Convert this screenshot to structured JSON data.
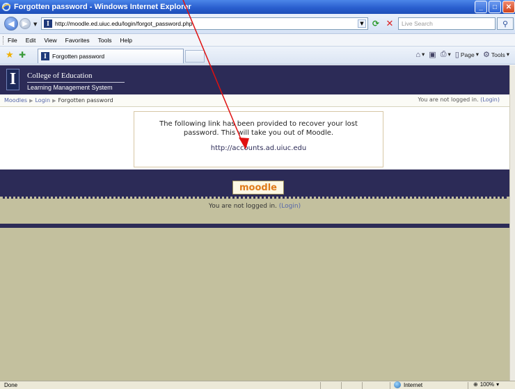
{
  "window": {
    "title": "Forgotten password - Windows Internet Explorer",
    "controls": [
      "minimize",
      "maximize",
      "close"
    ]
  },
  "addressbar": {
    "url": "http://moodle.ed.uiuc.edu/login/forgot_password.php",
    "search_placeholder": "Live Search"
  },
  "menubar": {
    "items": [
      {
        "label": "File"
      },
      {
        "label": "Edit"
      },
      {
        "label": "View"
      },
      {
        "label": "Favorites"
      },
      {
        "label": "Tools"
      },
      {
        "label": "Help"
      }
    ]
  },
  "tabs": {
    "active_tab": "Forgotten password"
  },
  "commandbar": {
    "page_label": "Page",
    "tools_label": "Tools"
  },
  "site": {
    "logo_letter": "I",
    "college": "College of Education",
    "system": "Learning Management System"
  },
  "breadcrumb": {
    "items": [
      "Moodles",
      "Login",
      "Forgotten password"
    ],
    "login_status": "You are not logged in.",
    "login_link": "(Login)"
  },
  "main": {
    "message": "The following link has been provided to recover your lost password. This will take you out of Moodle.",
    "link": "http://accounts.ad.uiuc.edu"
  },
  "footer": {
    "logo_text": "moodle",
    "login_status": "You are not logged in.",
    "login_link": "(Login)"
  },
  "statusbar": {
    "status": "Done",
    "zone": "Internet",
    "zoom": "100%"
  },
  "colors": {
    "header": "#2c2b57",
    "background": "#c3c09e",
    "annotation_arrow": "#e01010"
  }
}
